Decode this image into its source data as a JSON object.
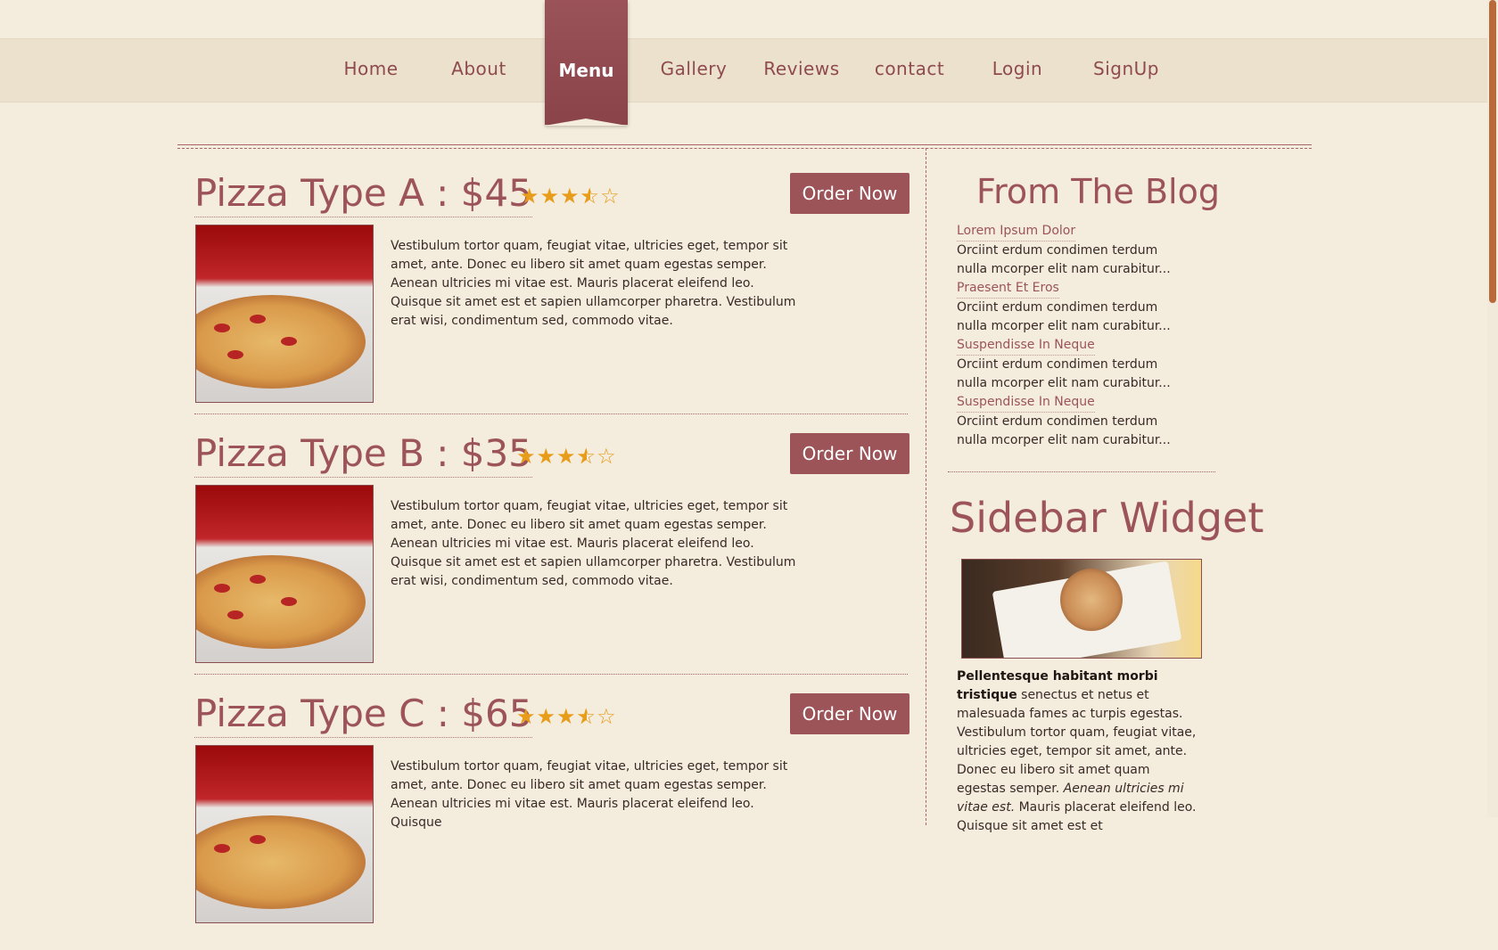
{
  "nav": {
    "items": [
      "Home",
      "About",
      "Menu",
      "Gallery",
      "Reviews",
      "contact",
      "Login",
      "SignUp"
    ],
    "active": "Menu"
  },
  "pizzas": [
    {
      "title": "Pizza Type A : $45",
      "rating": 3.5,
      "order_label": "Order Now",
      "description": "Vestibulum tortor quam, feugiat vitae, ultricies eget, tempor sit amet, ante. Donec eu libero sit amet quam egestas semper. Aenean ultricies mi vitae est. Mauris placerat eleifend leo. Quisque sit amet est et sapien ullamcorper pharetra. Vestibulum erat wisi, condimentum sed, commodo vitae."
    },
    {
      "title": "Pizza Type B : $35",
      "rating": 3.5,
      "order_label": "Order Now",
      "description": "Vestibulum tortor quam, feugiat vitae, ultricies eget, tempor sit amet, ante. Donec eu libero sit amet quam egestas semper. Aenean ultricies mi vitae est. Mauris placerat eleifend leo. Quisque sit amet est et sapien ullamcorper pharetra. Vestibulum erat wisi, condimentum sed, commodo vitae."
    },
    {
      "title": "Pizza Type C : $65",
      "rating": 3.5,
      "order_label": "Order Now",
      "description": "Vestibulum tortor quam, feugiat vitae, ultricies eget, tempor sit amet, ante. Donec eu libero sit amet quam egestas semper. Aenean ultricies mi vitae est. Mauris placerat eleifend leo. Quisque"
    }
  ],
  "blog": {
    "title": "From The Blog",
    "posts": [
      {
        "link": "Lorem Ipsum Dolor",
        "excerpt": "Orciint erdum condimen terdum nulla mcorper elit nam curabitur..."
      },
      {
        "link": "Praesent Et Eros",
        "excerpt": "Orciint erdum condimen terdum nulla mcorper elit nam curabitur..."
      },
      {
        "link": "Suspendisse In Neque",
        "excerpt": "Orciint erdum condimen terdum nulla mcorper elit nam curabitur..."
      },
      {
        "link": "Suspendisse In Neque",
        "excerpt": "Orciint erdum condimen terdum nulla mcorper elit nam curabitur..."
      }
    ]
  },
  "widget": {
    "title": "Sidebar Widget",
    "text_bold": "Pellentesque habitant morbi tristique",
    "text_body": " senectus et netus et malesuada fames ac turpis egestas. Vestibulum tortor quam, feugiat vitae, ultricies eget, tempor sit amet, ante. Donec eu libero sit amet quam egestas semper. ",
    "text_italic": "Aenean ultricies mi vitae est.",
    "text_tail": " Mauris placerat eleifend leo. Quisque sit amet est et"
  },
  "colors": {
    "accent": "#9c5459",
    "star": "#e79c1a",
    "background": "#f4ecdc"
  }
}
